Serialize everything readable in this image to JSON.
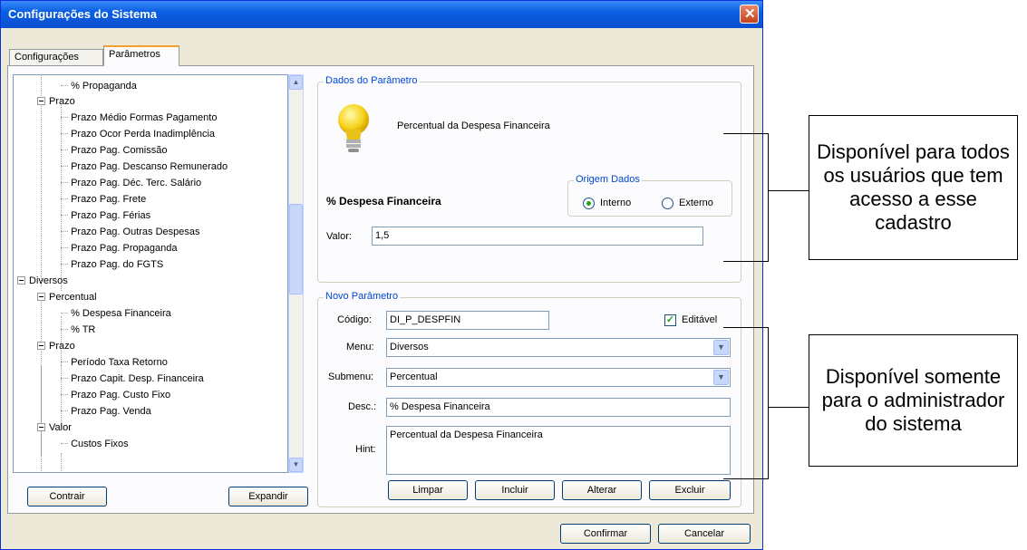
{
  "window": {
    "title": "Configurações do Sistema"
  },
  "tabs": [
    {
      "label": "Configurações"
    },
    {
      "label": "Parâmetros"
    }
  ],
  "tree": {
    "items": [
      {
        "label": "% Propaganda"
      },
      {
        "label": "Prazo"
      },
      {
        "label": "Prazo Médio Formas Pagamento"
      },
      {
        "label": "Prazo Ocor Perda Inadimplência"
      },
      {
        "label": "Prazo Pag. Comissão"
      },
      {
        "label": "Prazo Pag. Descanso Remunerado"
      },
      {
        "label": "Prazo Pag. Déc. Terc. Salário"
      },
      {
        "label": "Prazo Pag. Frete"
      },
      {
        "label": "Prazo Pag. Férias"
      },
      {
        "label": "Prazo Pag. Outras Despesas"
      },
      {
        "label": "Prazo Pag. Propaganda"
      },
      {
        "label": "Prazo Pag. do FGTS"
      },
      {
        "label": "Diversos"
      },
      {
        "label": "Percentual"
      },
      {
        "label": "% Despesa Financeira"
      },
      {
        "label": "% TR"
      },
      {
        "label": "Prazo"
      },
      {
        "label": "Período Taxa Retorno"
      },
      {
        "label": "Prazo Capit. Desp. Financeira"
      },
      {
        "label": "Prazo Pag. Custo Fixo"
      },
      {
        "label": "Prazo Pag. Venda"
      },
      {
        "label": "Valor"
      },
      {
        "label": "Custos Fixos"
      }
    ],
    "contrair_label": "Contrair",
    "expandir_label": "Expandir"
  },
  "dados": {
    "group_title": "Dados do Parâmetro",
    "description": "Percentual da Despesa Financeira",
    "param_name": "% Despesa Financeira",
    "origem_title": "Origem Dados",
    "interno_label": "Interno",
    "externo_label": "Externo",
    "valor_label": "Valor:",
    "valor_value": "1,5"
  },
  "novo": {
    "group_title": "Novo Parâmetro",
    "codigo_label": "Código:",
    "codigo_value": "DI_P_DESPFIN",
    "editavel_label": "Editável",
    "menu_label": "Menu:",
    "menu_value": "Diversos",
    "submenu_label": "Submenu:",
    "submenu_value": "Percentual",
    "desc_label": "Desc.:",
    "desc_value": "% Despesa Financeira",
    "hint_label": "Hint:",
    "hint_value": "Percentual da Despesa Financeira",
    "limpar_label": "Limpar",
    "incluir_label": "Incluir",
    "alterar_label": "Alterar",
    "excluir_label": "Excluir"
  },
  "footer": {
    "confirmar_label": "Confirmar",
    "cancelar_label": "Cancelar"
  },
  "callouts": {
    "top": "Disponível para todos os usuários que tem acesso a esse cadastro",
    "bottom": "Disponível somente para o administrador do sistema"
  }
}
